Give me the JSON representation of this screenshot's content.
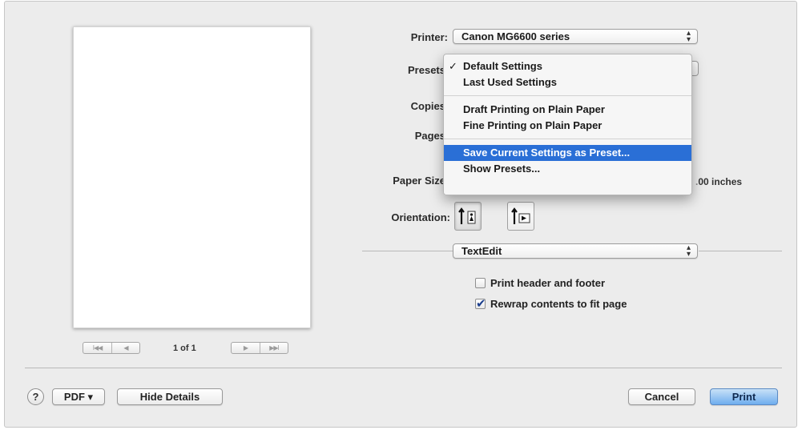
{
  "preview": {
    "first_glyph": "I◀◀",
    "prev_glyph": "◀",
    "next_glyph": "▶",
    "last_glyph": "▶▶I",
    "page_indicator": "1 of 1"
  },
  "printer": {
    "label": "Printer:",
    "value": "Canon MG6600 series"
  },
  "presets": {
    "label": "Presets",
    "menu": [
      {
        "label": "Default Settings",
        "checked": true
      },
      {
        "label": "Last Used Settings"
      },
      {
        "label": "Draft Printing on Plain Paper"
      },
      {
        "label": "Fine Printing on Plain Paper"
      },
      {
        "label": "Save Current Settings as Preset...",
        "highlighted": true
      },
      {
        "label": "Show Presets..."
      }
    ]
  },
  "copies": {
    "label": "Copies"
  },
  "pages": {
    "label": "Pages"
  },
  "paper_size": {
    "label": "Paper Size",
    "value_fragment": "00 inches"
  },
  "orientation": {
    "label": "Orientation:",
    "selected": "portrait"
  },
  "section": {
    "value": "TextEdit"
  },
  "options": {
    "print_header_footer": {
      "label": "Print header and footer",
      "checked": false
    },
    "rewrap": {
      "label": "Rewrap contents to fit page",
      "checked": true
    }
  },
  "footer": {
    "help": "?",
    "pdf": "PDF ▾",
    "hide_details": "Hide Details",
    "cancel": "Cancel",
    "print": "Print"
  },
  "colors": {
    "accent": "#2a6fd6",
    "default_button": "#6fadee",
    "dialog_bg": "#ececec"
  }
}
